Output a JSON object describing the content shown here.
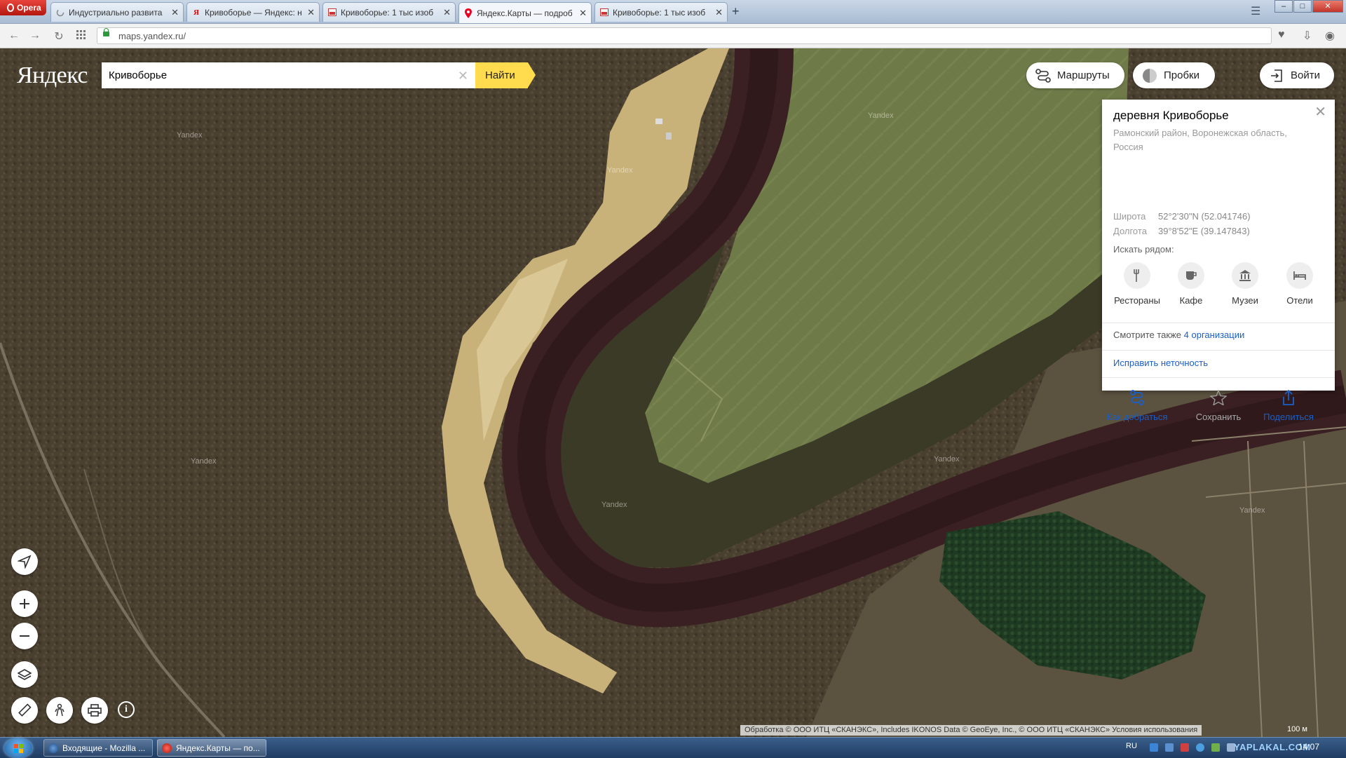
{
  "browser": {
    "opera_label": "Opera",
    "tabs": [
      {
        "title": "Индустриально развита",
        "icon": "loading-icon"
      },
      {
        "title": "Кривоборье — Яндекс: н",
        "icon": "yandex-icon"
      },
      {
        "title": "Кривоборье: 1 тыс изоб",
        "icon": "image-icon"
      },
      {
        "title": "Яндекс.Карты — подроб",
        "icon": "map-pin-icon"
      },
      {
        "title": "Кривоборье: 1 тыс изоб",
        "icon": "image-icon"
      }
    ],
    "new_tab": "+",
    "url": "maps.yandex.ru/",
    "window_controls": {
      "minimize": "–",
      "maximize": "□",
      "close": "✕"
    }
  },
  "map": {
    "logo": "Яндекс",
    "search": {
      "value": "Кривоборье",
      "button": "Найти",
      "clear": "✕"
    },
    "routes_label": "Маршруты",
    "traffic_label": "Пробки",
    "login_label": "Войти",
    "watermark": "Yandex",
    "card": {
      "title": "деревня Кривоборье",
      "address": "Рамонский район, Воронежская область, Россия",
      "lat_label": "Широта",
      "lat_value": "52°2'30\"N (52.041746)",
      "lon_label": "Долгота",
      "lon_value": "39°8'52\"E (39.147843)",
      "nearby_label": "Искать рядом:",
      "categories": [
        {
          "label": "Рестораны",
          "icon": "fork-knife-icon"
        },
        {
          "label": "Кафе",
          "icon": "cup-icon"
        },
        {
          "label": "Музеи",
          "icon": "museum-icon"
        },
        {
          "label": "Отели",
          "icon": "bed-icon"
        }
      ],
      "see_also_text": "Смотрите также",
      "see_also_link": "4 организации",
      "fix_link": "Исправить неточность",
      "actions": {
        "route": "Как добраться",
        "save": "Сохранить",
        "share": "Поделиться"
      },
      "close": "✕"
    },
    "copyright": "Обработка © ООО ИТЦ «СКАНЭКС», Includes IKONOS Data © GeoEye, Inc., © ООО ИТЦ «СКАНЭКС» Условия использования",
    "scale": "100 м",
    "info": "i"
  },
  "taskbar": {
    "items": [
      {
        "label": "Входящие - Mozilla ..."
      },
      {
        "label": "Яндекс.Карты — по..."
      }
    ],
    "lang": "RU",
    "clock": "14:07",
    "watermark": "YAPLAKAL.COM"
  },
  "colors": {
    "search_button": "#ffdb4d",
    "link": "#1a5fc7",
    "river": "#3a2022",
    "field": "#6e7a48"
  }
}
